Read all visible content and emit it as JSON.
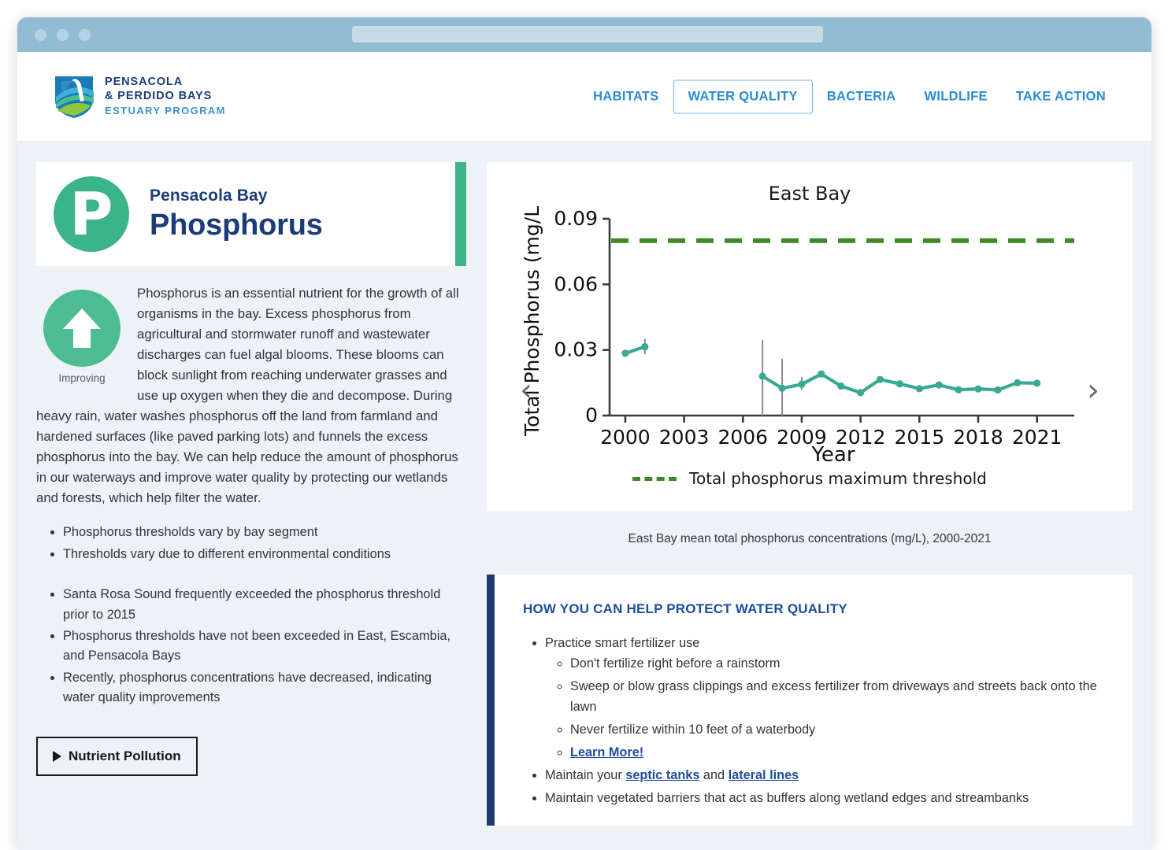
{
  "browser": {
    "url_value": ""
  },
  "header": {
    "logo": {
      "line1": "PENSACOLA",
      "line2": "& PERDIDO BAYS",
      "line3": "ESTUARY PROGRAM"
    },
    "nav": [
      {
        "label": "HABITATS",
        "active": false
      },
      {
        "label": "WATER QUALITY",
        "active": true
      },
      {
        "label": "BACTERIA",
        "active": false
      },
      {
        "label": "WILDLIFE",
        "active": false
      },
      {
        "label": "TAKE ACTION",
        "active": false
      }
    ]
  },
  "left_panel": {
    "badge_letter": "P",
    "subtitle": "Pensacola Bay",
    "title": "Phosphorus",
    "trend": {
      "icon": "up-arrow-icon",
      "label": "Improving"
    },
    "body_text": "Phosphorus is an essential nutrient for the growth of all organisms in the bay. Excess phosphorus from agricultural and stormwater runoff and wastewater discharges can fuel algal blooms. These blooms can block sunlight from reaching underwater grasses and use up oxygen when they die and decompose. During heavy rain, water washes phosphorus off the land from farmland and hardened surfaces (like paved parking lots) and funnels the excess phosphorus into the bay. We can help reduce the amount of phosphorus in our waterways and improve water quality by protecting our wetlands and forests, which help filter the water.",
    "bullets_group_1": [
      "Phosphorus thresholds vary by bay segment",
      "Thresholds vary due to different environmental conditions"
    ],
    "bullets_group_2": [
      "Santa Rosa Sound frequently exceeded the phosphorus threshold prior to 2015",
      "Phosphorus thresholds have not been exceeded in East, Escambia, and Pensacola Bays",
      "Recently, phosphorus concentrations have decreased, indicating water quality improvements"
    ],
    "action_button": "Nutrient Pollution"
  },
  "chart_caption": "East Bay mean total phosphorus concentrations (mg/L), 2000-2021",
  "carousel": {
    "prev": "‹",
    "next": "›"
  },
  "help_panel": {
    "title": "HOW YOU CAN HELP PROTECT WATER QUALITY",
    "items": [
      {
        "text": "Practice smart fertilizer use",
        "children": [
          {
            "text": "Don't fertilize right before a rainstorm"
          },
          {
            "text": "Sweep or blow grass clippings and excess fertilizer from driveways and streets back onto the lawn"
          },
          {
            "text": "Never fertilize within 10 feet of a waterbody"
          },
          {
            "text": "Learn More!",
            "link": true
          }
        ]
      },
      {
        "text_parts": [
          {
            "t": "Maintain your "
          },
          {
            "t": "septic tanks",
            "link": true
          },
          {
            "t": " and "
          },
          {
            "t": "lateral lines",
            "link": true
          }
        ]
      },
      {
        "text": "Maintain vegetated barriers that act as buffers along wetland edges and streambanks"
      }
    ]
  },
  "colors": {
    "brand_navy": "#1b3c78",
    "brand_blue": "#2b8cd4",
    "accent_green": "#3cb489",
    "series_teal": "#3aa991",
    "threshold_green": "#3f8a28",
    "page_bg": "#edf2f7",
    "titlebar": "#92bcd2"
  },
  "chart_data": {
    "type": "line",
    "title": "East Bay",
    "xlabel": "Year",
    "ylabel": "Total Phosphorus (mg/L)",
    "xlim": [
      1999.2,
      2022.5
    ],
    "ylim": [
      0,
      0.09
    ],
    "xticks": [
      2000,
      2003,
      2006,
      2009,
      2012,
      2015,
      2018,
      2021
    ],
    "yticks": [
      0,
      0.03,
      0.06,
      0.09
    ],
    "ytick_labels": [
      "0",
      "0.03",
      "0.06",
      "0.09"
    ],
    "grid": false,
    "legend": [
      {
        "label": "Total phosphorus maximum threshold",
        "style": "dashed",
        "color": "#3f8a28"
      }
    ],
    "threshold": {
      "label": "Total phosphorus maximum threshold",
      "value": 0.08,
      "color": "#3f8a28"
    },
    "series": [
      {
        "name": "East Bay mean total phosphorus",
        "color": "#3aa991",
        "marker": "circle",
        "segments": [
          {
            "x": [
              2000,
              2001
            ],
            "y": [
              0.0285,
              0.0315
            ],
            "yerr_low": [
              0.0285,
              0.028
            ],
            "yerr_high": [
              0.0285,
              0.035
            ]
          },
          {
            "x": [
              2007,
              2008,
              2009,
              2010,
              2011,
              2012,
              2013,
              2014,
              2015,
              2016,
              2017,
              2018,
              2019,
              2020,
              2021
            ],
            "y": [
              0.018,
              0.0125,
              0.0143,
              0.019,
              0.0135,
              0.0105,
              0.0165,
              0.0145,
              0.0123,
              0.014,
              0.0118,
              0.0122,
              0.0117,
              0.015,
              0.0148
            ],
            "yerr_low": [
              0.0,
              0.0,
              0.0118,
              0.0175,
              0.0135,
              0.0105,
              0.016,
              0.0145,
              0.0123,
              0.014,
              0.0118,
              0.0118,
              0.0117,
              0.0143,
              0.0138
            ],
            "yerr_high": [
              0.0345,
              0.026,
              0.0175,
              0.0205,
              0.0135,
              0.0105,
              0.017,
              0.0145,
              0.0123,
              0.014,
              0.0118,
              0.0126,
              0.0117,
              0.016,
              0.0158
            ]
          }
        ]
      }
    ]
  }
}
